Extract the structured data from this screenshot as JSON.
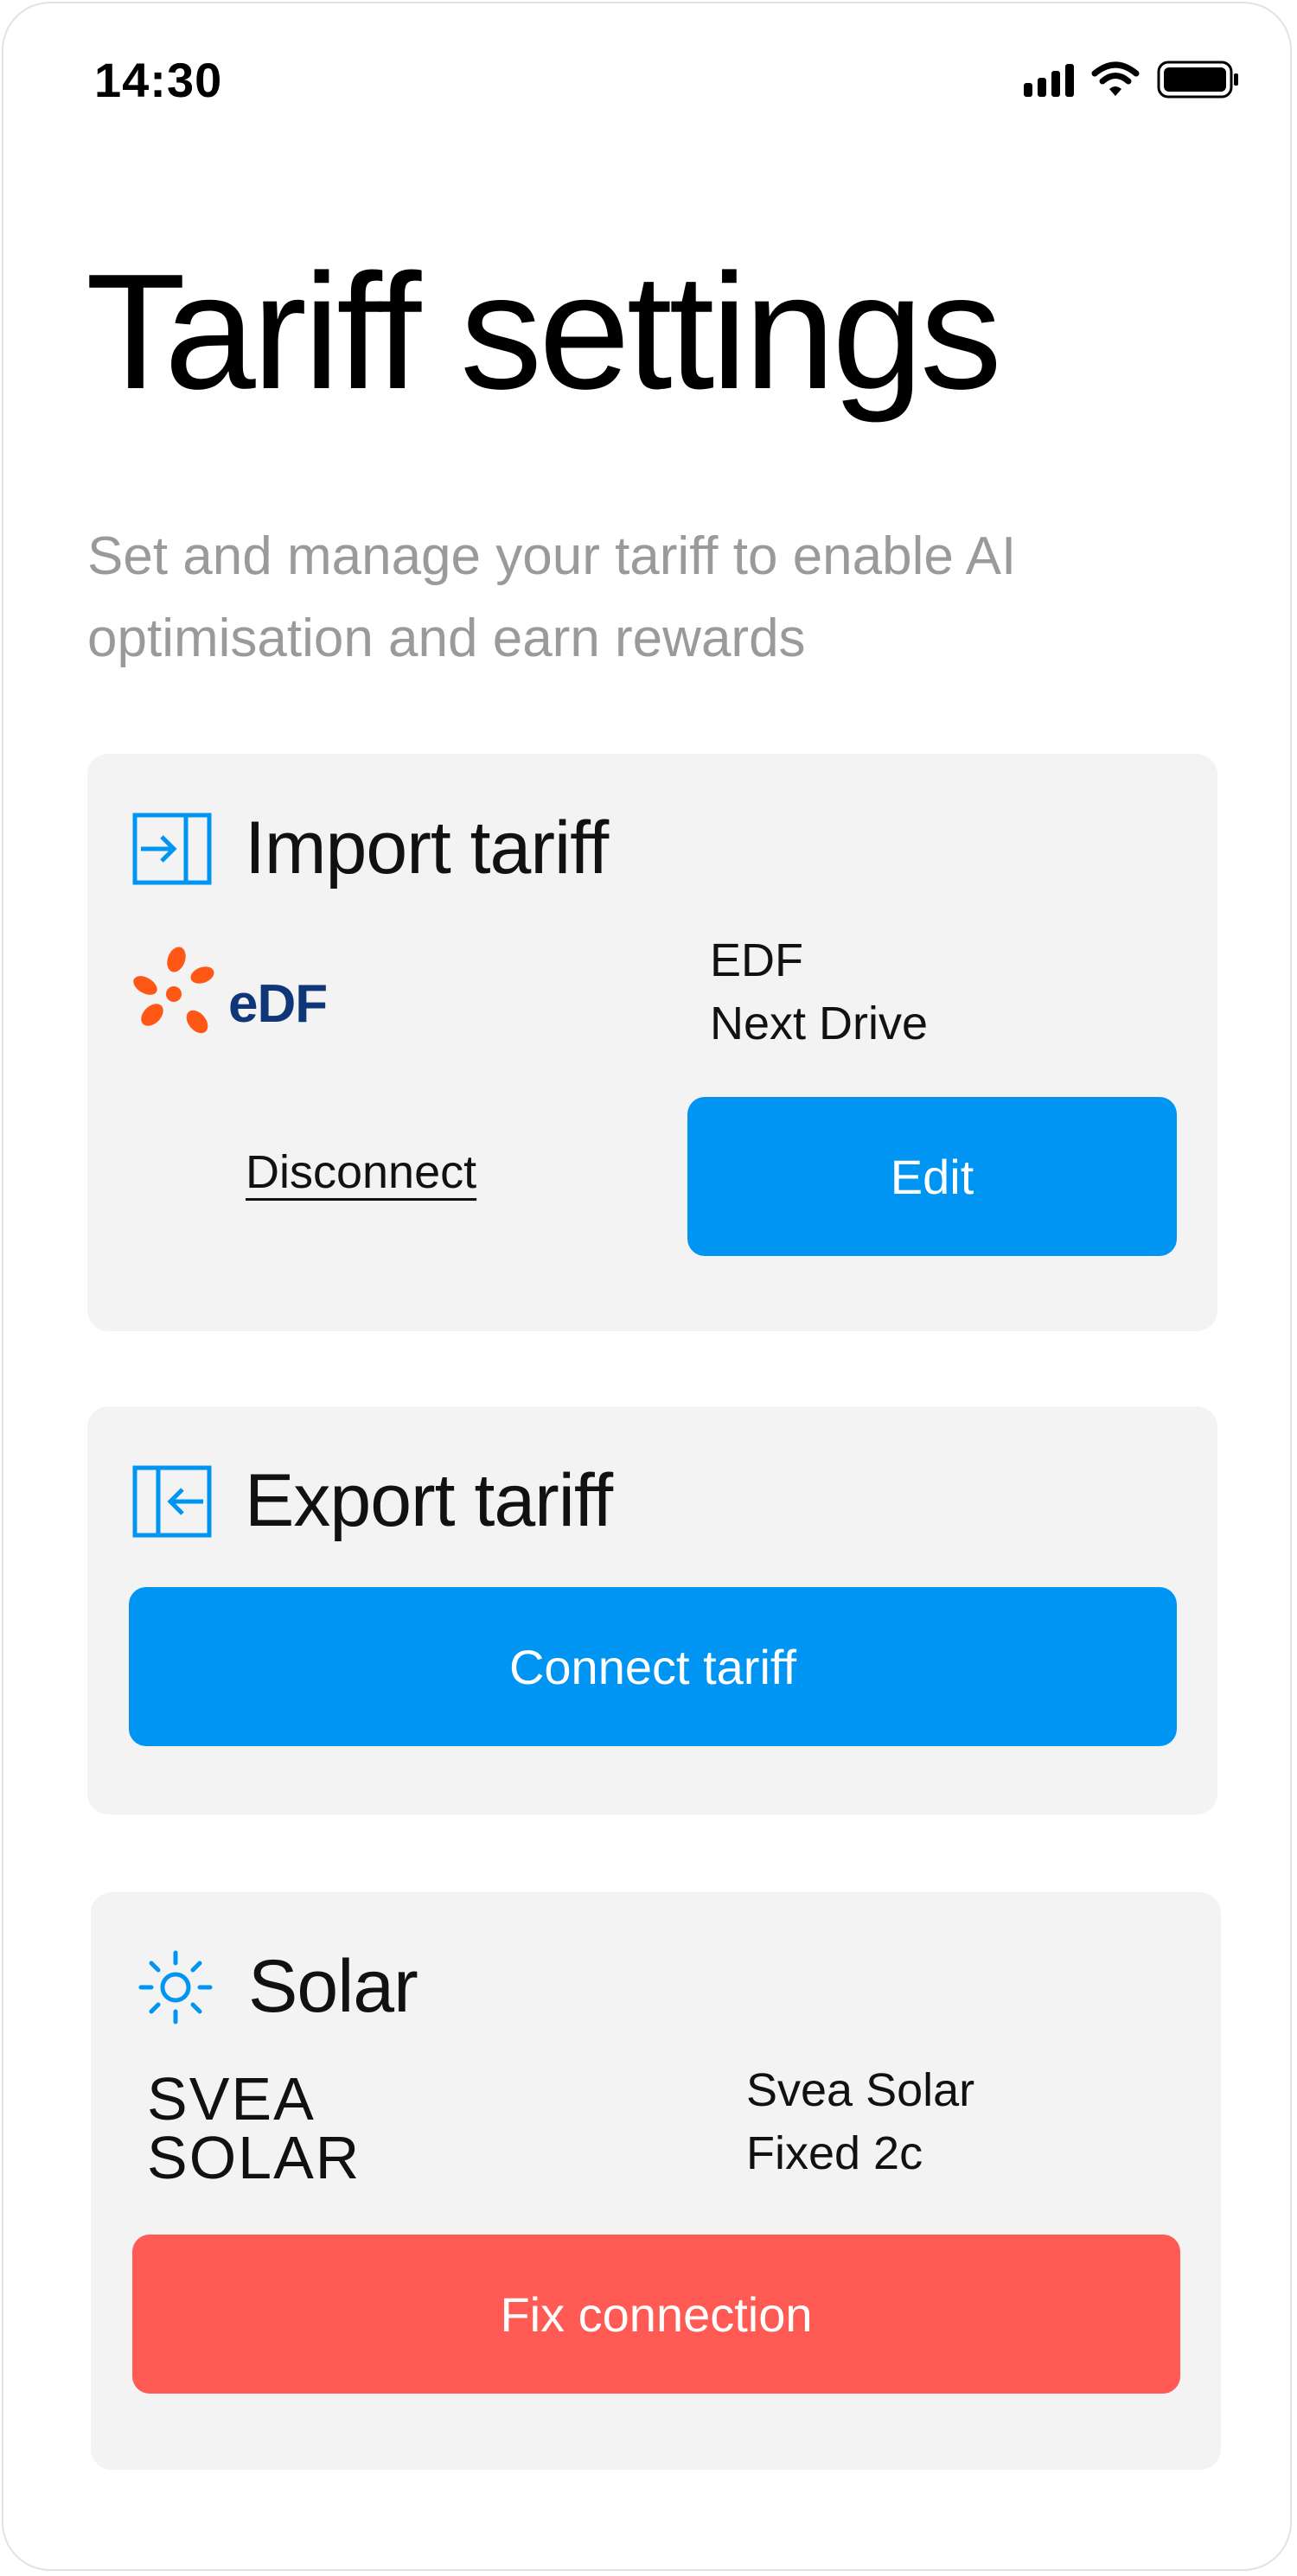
{
  "status_bar": {
    "time": "14:30",
    "icons": [
      "signal-icon",
      "wifi-icon",
      "battery-icon"
    ]
  },
  "header": {
    "title": "Tariff settings",
    "subtitle": "Set and manage your tariff to enable AI optimisation and earn rewards"
  },
  "import_card": {
    "title": "Import tariff",
    "icon": "import-icon",
    "provider_logo": "EDF",
    "provider_name": "EDF",
    "plan_name": "Next Drive",
    "disconnect_label": "Disconnect",
    "edit_label": "Edit"
  },
  "export_card": {
    "title": "Export tariff",
    "icon": "export-icon",
    "connect_label": "Connect tariff"
  },
  "solar_card": {
    "title": "Solar",
    "icon": "sun-icon",
    "logo_line1": "SVEA",
    "logo_line2": "SOLAR",
    "provider_name": "Svea Solar",
    "plan_name": "Fixed 2c",
    "fix_label": "Fix connection"
  },
  "colors": {
    "accent_blue": "#0095f2",
    "error_red": "#ff5a53",
    "card_bg": "#f3f3f3",
    "subtitle_gray": "#9a9a9a",
    "edf_orange": "#fe5716",
    "edf_navy": "#10367a"
  }
}
